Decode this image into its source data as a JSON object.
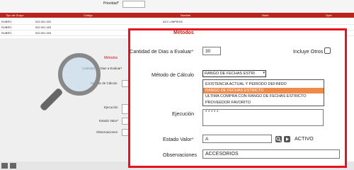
{
  "header": {
    "prioridad_label": "Prioridad*"
  },
  "grid": {
    "columns": [
      "Tipo de Grupo",
      "Código",
      "Nombre",
      "Nodo",
      "Oper"
    ],
    "rows": [
      {
        "tipo": "RUBRO",
        "codigo": "002.001.002",
        "nombre": "ACC.LIMPIEZA"
      },
      {
        "tipo": "RUBRO",
        "codigo": "002.001.003",
        "nombre": ""
      },
      {
        "tipo": "RUBRO",
        "codigo": "002.001.004",
        "nombre": ""
      }
    ]
  },
  "background_form": {
    "metodos": "Métodos",
    "cantidad": "Cantidad de Dias a Evaluar*",
    "metodo": "Método de Cálculo",
    "ejecucion": "Ejecución",
    "estado": "Estado Valor*",
    "observaciones": "Observaciones"
  },
  "panel": {
    "title": "Métodos",
    "dias_label": "Cantidad de Dias a Evaluar",
    "dias_value": "30",
    "incluye_label": "Incluye Otros",
    "metodo_label": "Método de Cálculo",
    "metodo_selected": "RANGO DE FECHAS ESTRI",
    "options": [
      "EXISTENCIA ACTUAL Y PERIODO DEFINIDO",
      "RANGO DE FECHAS ESTRICTO",
      "ULTIMA COMPRA CON RANGO DE FECHAS ESTRICTO",
      "PROVEEDOR FAVORITO"
    ],
    "ejecucion_label": "Ejecución",
    "ejecucion_value": "* * * * *",
    "estado_label": "Estado Valor",
    "estado_value": "A",
    "estado_desc": "ACTIVO",
    "obs_label": "Observaciones",
    "obs_value": "ACCESORIOS"
  },
  "colors": {
    "accent": "#c3261e",
    "highlight_border": "#e8121c",
    "selected_option": "#f08a4b"
  },
  "icons": [
    "magnifier-icon",
    "search-icon",
    "arrow-right-icon"
  ]
}
